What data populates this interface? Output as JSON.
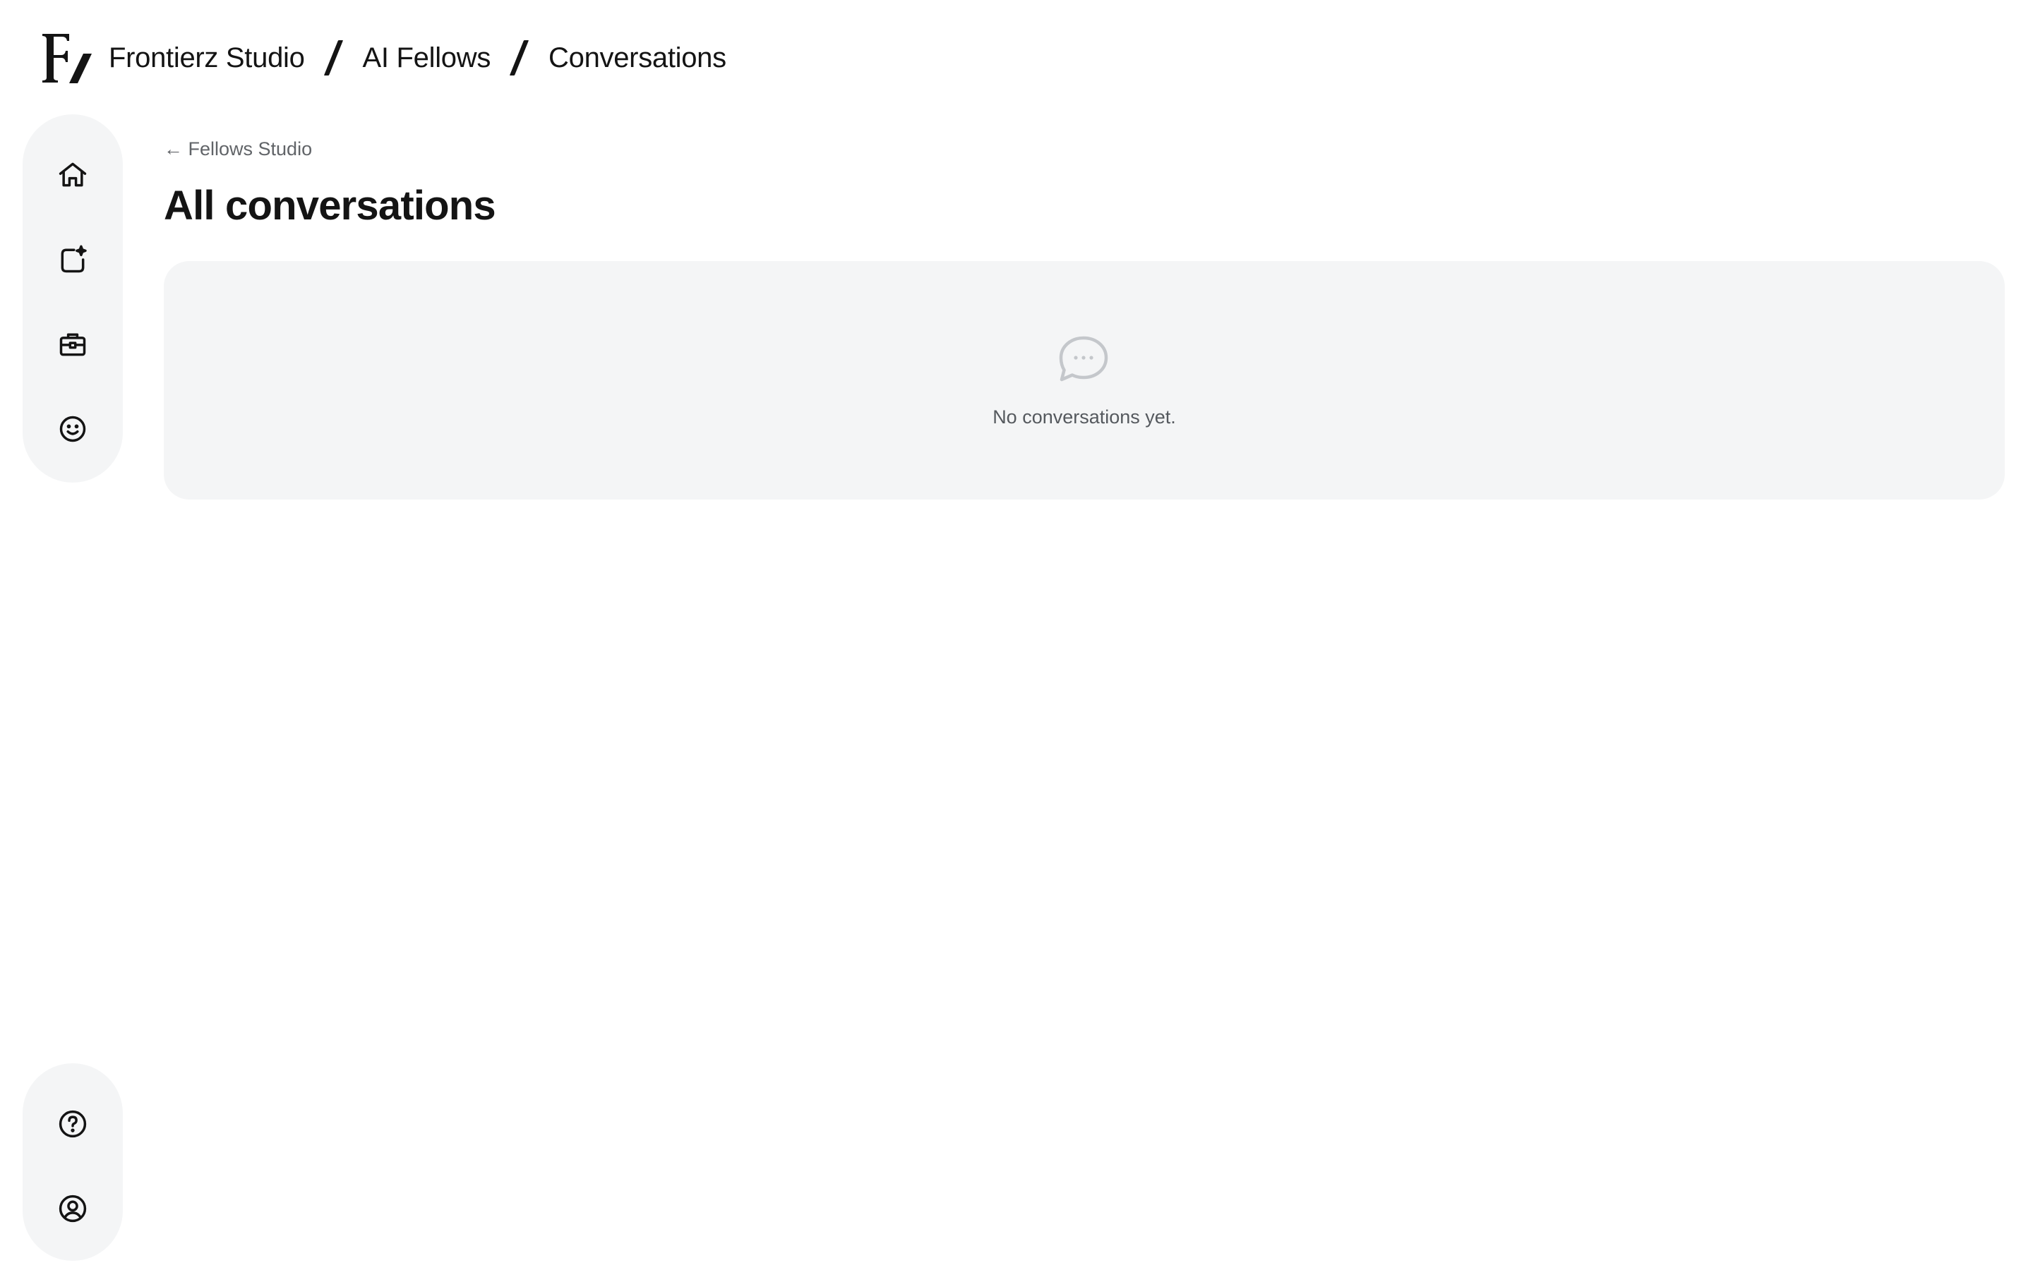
{
  "header": {
    "logo": "F/",
    "breadcrumbs": [
      {
        "label": "Frontierz Studio"
      },
      {
        "label": "AI Fellows"
      },
      {
        "label": "Conversations"
      }
    ]
  },
  "sidebar": {
    "top_items": [
      {
        "name": "home",
        "icon": "home-icon"
      },
      {
        "name": "new-post",
        "icon": "square-sparkle-icon"
      },
      {
        "name": "briefcase",
        "icon": "briefcase-icon"
      },
      {
        "name": "smiley",
        "icon": "smiley-icon"
      }
    ],
    "bottom_items": [
      {
        "name": "help",
        "icon": "help-circle-icon"
      },
      {
        "name": "account",
        "icon": "user-circle-icon"
      }
    ]
  },
  "main": {
    "back_link": "← Fellows Studio",
    "title": "All conversations",
    "empty_state": {
      "icon": "chat-bubble-icon",
      "message": "No conversations yet."
    }
  },
  "colors": {
    "text": "#141414",
    "muted": "#616468",
    "panel": "#f4f5f6",
    "icon_muted": "#c4c7cb"
  }
}
